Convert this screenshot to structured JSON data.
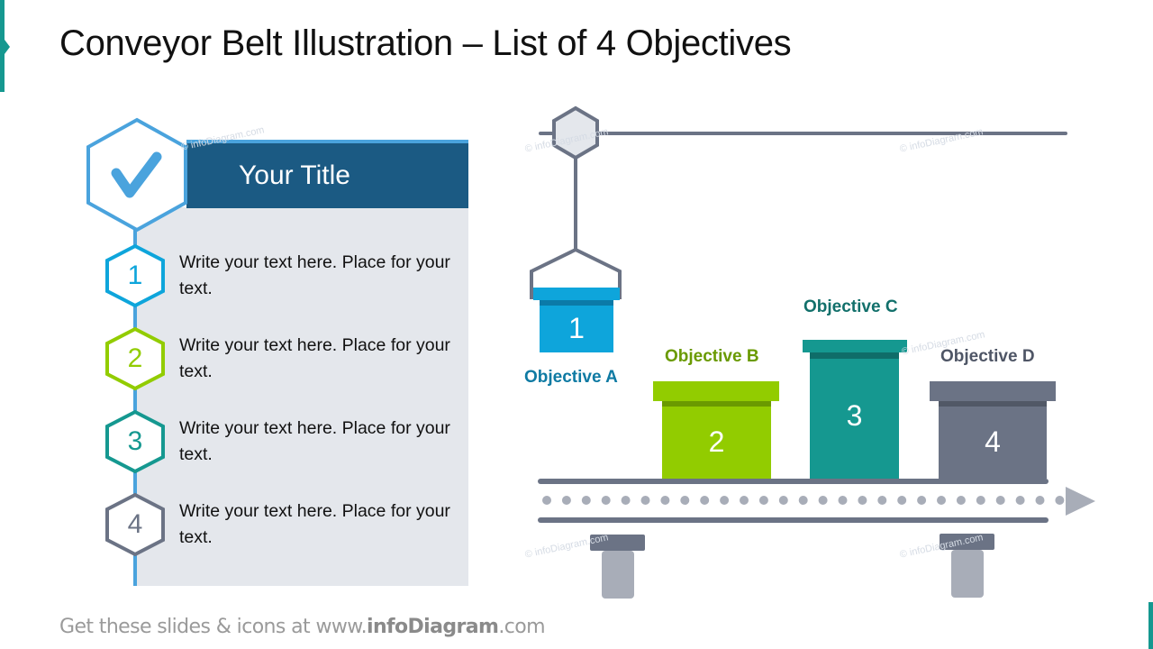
{
  "page": {
    "title": "Conveyor Belt Illustration – List of 4 Objectives",
    "footer_prefix": "Get these slides & icons at www.",
    "footer_brand": "infoDiagram",
    "footer_suffix": ".com",
    "watermark": "© infoDiagram.com"
  },
  "colors": {
    "accent_teal": "#159890",
    "header_blue": "#1b5a83",
    "header_line": "#4aa3dd",
    "panel_bg": "#e4e7ec",
    "belt_gray": "#6b7385",
    "belt_light": "#a8adb8",
    "step1": "#0ea5db",
    "step2": "#92cc00",
    "step3": "#159890",
    "step4": "#6b7385"
  },
  "panel": {
    "title": "Your Title",
    "header_icon": "checkmark-icon",
    "items": [
      {
        "number": "1",
        "text": "Write your text here. Place for your text.",
        "color": "#0ea5db"
      },
      {
        "number": "2",
        "text": "Write your text here. Place for your text.",
        "color": "#92cc00"
      },
      {
        "number": "3",
        "text": "Write your text here. Place for your text.",
        "color": "#159890"
      },
      {
        "number": "4",
        "text": "Write your text here. Place for your text.",
        "color": "#6b7385"
      }
    ]
  },
  "conveyor": {
    "objectives": [
      {
        "label": "Objective A",
        "number": "1",
        "label_color": "#0e7aa3",
        "color": "#0ea5db",
        "dark": "#0b7aa8"
      },
      {
        "label": "Objective B",
        "number": "2",
        "label_color": "#6a9a00",
        "color": "#92cc00",
        "dark": "#6a9a00"
      },
      {
        "label": "Objective C",
        "number": "3",
        "label_color": "#12706b",
        "color": "#159890",
        "dark": "#0f6d69"
      },
      {
        "label": "Objective D",
        "number": "4",
        "label_color": "#4f5666",
        "color": "#6b7385",
        "dark": "#515866"
      }
    ],
    "direction_icon": "arrow-right-icon"
  }
}
